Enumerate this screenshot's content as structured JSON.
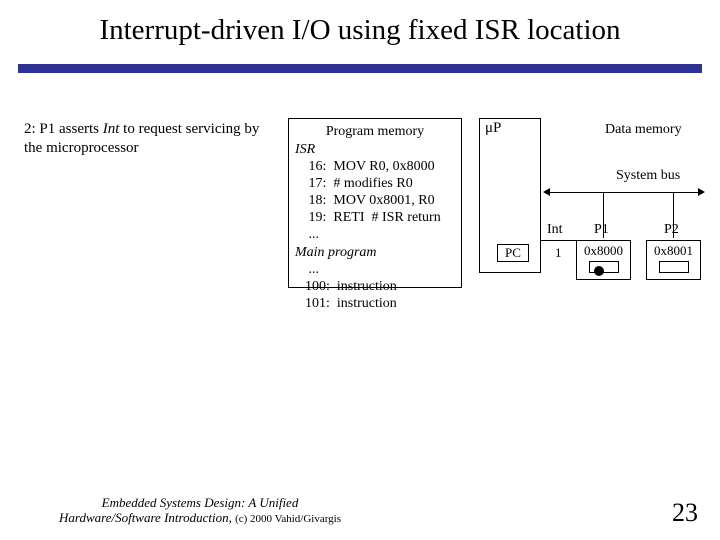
{
  "title": "Interrupt-driven I/O using fixed ISR location",
  "step": {
    "prefix": "2: P1 asserts ",
    "int_word": "Int",
    "suffix": " to request servicing by the microprocessor"
  },
  "progmem": {
    "title": "Program memory",
    "isr_label": "ISR",
    "lines": [
      " 16:  MOV R0, 0x8000",
      " 17:  # modifies R0",
      " 18:  MOV 0x8001, R0",
      " 19:  RETI  # ISR return",
      " ..."
    ],
    "main_label": "Main program",
    "main_lines": [
      " ...",
      "100:  instruction",
      "101:  instruction"
    ]
  },
  "mp": {
    "label": "μP",
    "pc": "PC"
  },
  "int": {
    "label": "Int",
    "value": "1"
  },
  "datamem": "Data memory",
  "sysbus": "System bus",
  "p1": {
    "label": "P1",
    "addr": "0x8000"
  },
  "p2": {
    "label": "P2",
    "addr": "0x8001"
  },
  "footer": {
    "line1": "Embedded Systems Design: A Unified",
    "line2_ital": "Hardware/Software Introduction, ",
    "line2_small": "(c) 2000 Vahid/Givargis"
  },
  "page": "23"
}
